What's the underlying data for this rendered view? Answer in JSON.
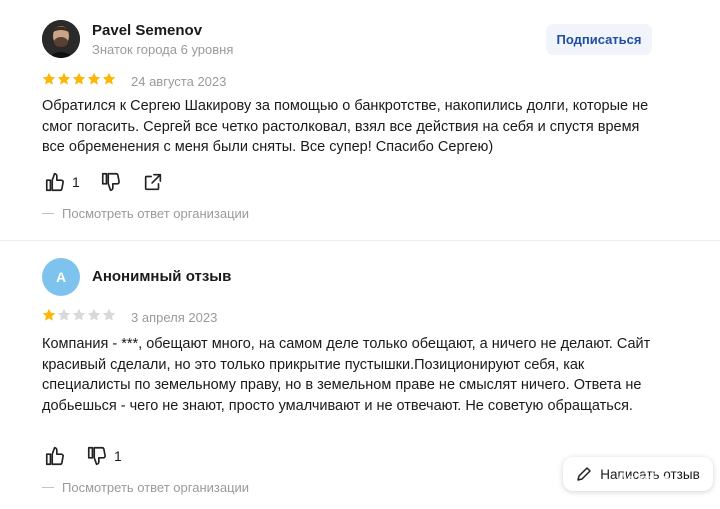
{
  "reviews": [
    {
      "author": "Pavel Semenov",
      "level": "Знаток города 6 уровня",
      "subscribe_label": "Подписаться",
      "rating": 5,
      "date": "24 августа 2023",
      "text": "Обратился к Сергею Шакирову за помощью о банкротстве, накопились долги, которые не смог погасить. Сергей все четко растолковал, взял все действия на себя и спустя время все обременения с меня были сняты. Все супер! Спасибо Сергею)",
      "likes": "1",
      "org_reply_label": "Посмотреть ответ организации"
    },
    {
      "author": "Анонимный отзыв",
      "avatar_letter": "А",
      "rating": 1,
      "date": "3 апреля 2023",
      "text": "Компания - ***, обещают много, на самом деле только обещают, а ничего не делают. Сайт красивый сделали, но это только прикрытие пустышки.Позиционируют себя, как специалисты по земельному праву, но в земельном праве не смыслят ничего. Ответа не добьешься - чего не знают, просто умалчивают и не отвечают. Не советую обращаться.",
      "dislikes": "1",
      "org_reply_label": "Посмотреть ответ организации"
    }
  ],
  "write_review_label": "Написать отзыв",
  "watermark": "Avito",
  "colors": {
    "star_filled": "#fcb70a",
    "star_empty": "#d9d9d9",
    "subscribe_text": "#1e4fa3",
    "anon_avatar": "#7ec3ee"
  }
}
